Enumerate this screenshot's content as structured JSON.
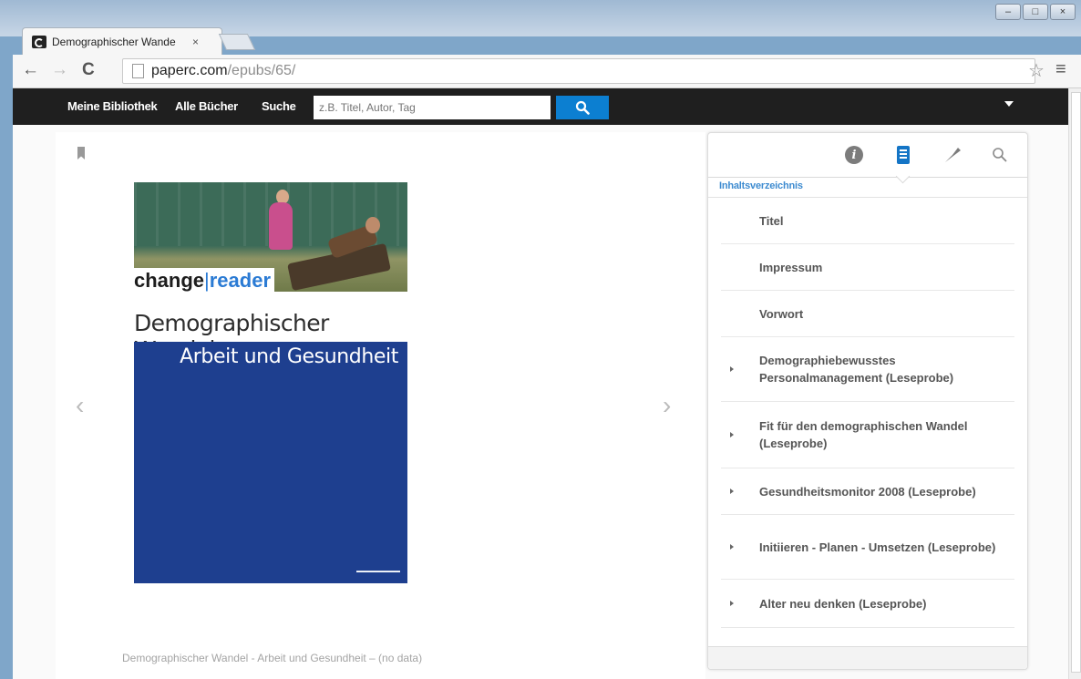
{
  "browser": {
    "tab_title": "Demographischer Wande",
    "tab_close": "×",
    "url_host": "paperc.com",
    "url_path": "/epubs/65/",
    "window_controls": [
      "minimize-icon",
      "maximize-icon",
      "close-icon"
    ]
  },
  "site_nav": {
    "links": [
      "Meine Bibliothek",
      "Alle Bücher",
      "Suche"
    ],
    "search_placeholder": "z.B. Titel, Autor, Tag",
    "accent_color": "#0c7fd1"
  },
  "book": {
    "brand_change": "change",
    "brand_separator": "|",
    "brand_reader": "reader",
    "title": "Demographischer Wandel",
    "subtitle": "Arbeit und Gesundheit",
    "cover_color": "#1e3f8f",
    "footer_caption": "Demographischer Wandel - Arbeit und Gesundheit – (no data)"
  },
  "panel": {
    "tools": [
      "info-icon",
      "toc-icon",
      "tag-icon",
      "search-icon"
    ],
    "heading": "Inhaltsverzeichnis",
    "items": [
      {
        "label": "Titel",
        "expandable": false
      },
      {
        "label": "Impressum",
        "expandable": false
      },
      {
        "label": "Vorwort",
        "expandable": false
      },
      {
        "label": "Demographiebewusstes Personalmanagement (Leseprobe)",
        "expandable": true
      },
      {
        "label": "Fit für den demographischen Wandel (Leseprobe)",
        "expandable": true
      },
      {
        "label": "Gesundheitsmonitor 2008 (Leseprobe)",
        "expandable": true
      },
      {
        "label": "Initiieren - Planen - Umsetzen (Leseprobe)",
        "expandable": true
      },
      {
        "label": "Alter neu denken (Leseprobe)",
        "expandable": true
      }
    ]
  }
}
